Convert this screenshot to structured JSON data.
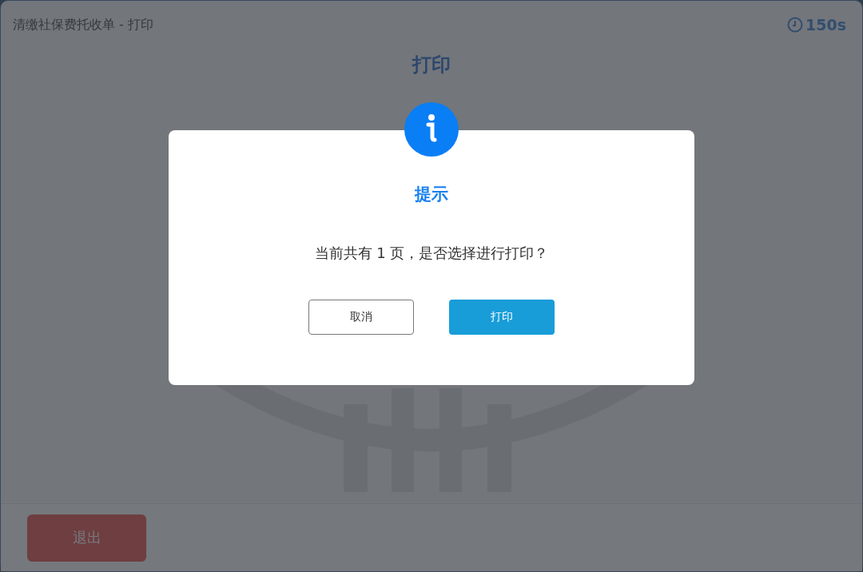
{
  "header": {
    "title": "清缴社保费托收单 - 打印",
    "countdown": "150s"
  },
  "page_title": "打印",
  "dialog": {
    "title": "提示",
    "message": "当前共有 1 页，是否选择进行打印？",
    "buttons": [
      {
        "label": "取消",
        "kind": "secondary"
      },
      {
        "label": "打印",
        "kind": "primary"
      }
    ]
  },
  "footer": {
    "exit_button": "退出"
  }
}
